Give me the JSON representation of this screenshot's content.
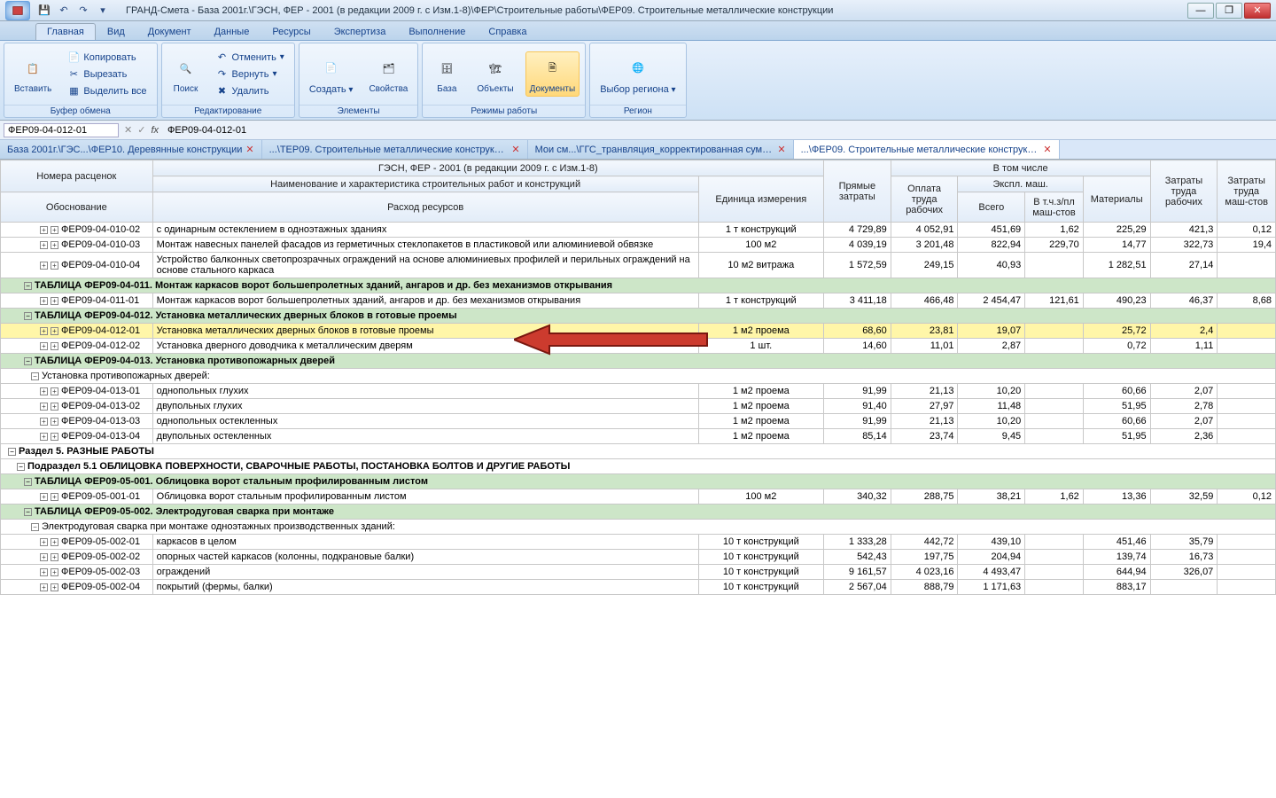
{
  "app_title": "ГРАНД-Смета - База 2001г.\\ГЭСН, ФЕР - 2001 (в редакции 2009 г. с Изм.1-8)\\ФЕР\\Строительные работы\\ФЕР09. Строительные металлические конструкции",
  "tabs": [
    "Главная",
    "Вид",
    "Документ",
    "Данные",
    "Ресурсы",
    "Экспертиза",
    "Выполнение",
    "Справка"
  ],
  "ribbon": {
    "paste": "Вставить",
    "copy": "Копировать",
    "cut": "Вырезать",
    "selectall": "Выделить все",
    "g_clipboard": "Буфер обмена",
    "search": "Поиск",
    "undo": "Отменить",
    "redo": "Вернуть",
    "delete": "Удалить",
    "g_edit": "Редактирование",
    "create": "Создать",
    "props": "Свойства",
    "g_elements": "Элементы",
    "base": "База",
    "objects": "Объекты",
    "docs": "Документы",
    "g_modes": "Режимы работы",
    "region": "Выбор региона",
    "g_region": "Регион"
  },
  "formula": {
    "name": "ФЕР09-04-012-01",
    "fx": "fx",
    "value": "ФЕР09-04-012-01"
  },
  "doc_tabs": [
    {
      "t": "База 2001г.\\ГЭС...\\ФЕР10. Деревянные конструкции",
      "a": false
    },
    {
      "t": "...\\ТЕР09. Строительные металлические конструкции",
      "a": false
    },
    {
      "t": "Мои см...\\ГГС_транвляция_корректированная сумма",
      "a": false
    },
    {
      "t": "...\\ФЕР09. Строительные металлические конструкции",
      "a": true
    }
  ],
  "headers": {
    "col_a1": "Номера расценок",
    "col_a2": "Обоснование",
    "col_b1": "Наименование и характеристика строительных работ и конструкций",
    "col_b2": "Расход ресурсов",
    "col_c1": "Единица измерения",
    "col_d": "Прямые затраты",
    "col_e": "В том числе",
    "col_e1": "Оплата труда рабочих",
    "col_e2": "Экспл. маш.",
    "col_e2a": "Всего",
    "col_e2b": "В т.ч.з/пл маш-стов",
    "col_e3": "Материалы",
    "col_f": "Затраты труда рабочих",
    "col_g": "Затраты труда маш-стов"
  },
  "rows": [
    {
      "type": "data",
      "ind": 38,
      "tw": "++",
      "code": "ФЕР09-04-010-02",
      "name": "с одинарным остеклением в одноэтажных зданиях",
      "unit": "1 т конструкций",
      "vals": [
        "4 729,89",
        "4 052,91",
        "451,69",
        "1,62",
        "225,29",
        "421,3",
        "0,12"
      ]
    },
    {
      "type": "data",
      "ind": 38,
      "tw": "++",
      "code": "ФЕР09-04-010-03",
      "name": "Монтаж навесных панелей фасадов из герметичных стеклопакетов в пластиковой или алюминиевой обвязке",
      "unit": "100 м2",
      "vals": [
        "4 039,19",
        "3 201,48",
        "822,94",
        "229,70",
        "14,77",
        "322,73",
        "19,4"
      ]
    },
    {
      "type": "data",
      "ind": 38,
      "tw": "++",
      "code": "ФЕР09-04-010-04",
      "name": "Устройство балконных светопрозрачных ограждений на основе алюминиевых профилей и перильных ограждений на основе стального каркаса",
      "unit": "10 м2 витража",
      "vals": [
        "1 572,59",
        "249,15",
        "40,93",
        "",
        "1 282,51",
        "27,14",
        ""
      ]
    },
    {
      "type": "green",
      "ind": 20,
      "tw": "-",
      "code": "ТАБЛИЦА ФЕР09-04-011.",
      "name": "Монтаж каркасов ворот большепролетных зданий, ангаров и др. без механизмов открывания"
    },
    {
      "type": "data",
      "ind": 38,
      "tw": "++",
      "code": "ФЕР09-04-011-01",
      "name": "Монтаж каркасов ворот большепролетных зданий, ангаров и др. без механизмов открывания",
      "unit": "1 т конструкций",
      "vals": [
        "3 411,18",
        "466,48",
        "2 454,47",
        "121,61",
        "490,23",
        "46,37",
        "8,68"
      ]
    },
    {
      "type": "green",
      "ind": 20,
      "tw": "-",
      "code": "ТАБЛИЦА ФЕР09-04-012.",
      "name": "Установка металлических дверных блоков в готовые проемы"
    },
    {
      "type": "sel",
      "ind": 38,
      "tw": "++",
      "code": "ФЕР09-04-012-01",
      "name": "Установка металлических дверных блоков в готовые проемы",
      "unit": "1 м2 проема",
      "vals": [
        "68,60",
        "23,81",
        "19,07",
        "",
        "25,72",
        "2,4",
        ""
      ]
    },
    {
      "type": "data",
      "ind": 38,
      "tw": "++",
      "code": "ФЕР09-04-012-02",
      "name": "Установка дверного доводчика к металлическим дверям",
      "unit": "1 шт.",
      "vals": [
        "14,60",
        "11,01",
        "2,87",
        "",
        "0,72",
        "1,11",
        ""
      ]
    },
    {
      "type": "green",
      "ind": 20,
      "tw": "-",
      "code": "ТАБЛИЦА ФЕР09-04-013.",
      "name": "Установка противопожарных дверей"
    },
    {
      "type": "sub",
      "ind": 28,
      "tw": "-",
      "name": "Установка противопожарных дверей:"
    },
    {
      "type": "data",
      "ind": 38,
      "tw": "++",
      "code": "ФЕР09-04-013-01",
      "name": "однопольных глухих",
      "unit": "1 м2 проема",
      "vals": [
        "91,99",
        "21,13",
        "10,20",
        "",
        "60,66",
        "2,07",
        ""
      ]
    },
    {
      "type": "data",
      "ind": 38,
      "tw": "++",
      "code": "ФЕР09-04-013-02",
      "name": "двупольных глухих",
      "unit": "1 м2 проема",
      "vals": [
        "91,40",
        "27,97",
        "11,48",
        "",
        "51,95",
        "2,78",
        ""
      ]
    },
    {
      "type": "data",
      "ind": 38,
      "tw": "++",
      "code": "ФЕР09-04-013-03",
      "name": "однопольных остекленных",
      "unit": "1 м2 проема",
      "vals": [
        "91,99",
        "21,13",
        "10,20",
        "",
        "60,66",
        "2,07",
        ""
      ]
    },
    {
      "type": "data",
      "ind": 38,
      "tw": "++",
      "code": "ФЕР09-04-013-04",
      "name": "двупольных остекленных",
      "unit": "1 м2 проема",
      "vals": [
        "85,14",
        "23,74",
        "9,45",
        "",
        "51,95",
        "2,36",
        ""
      ]
    },
    {
      "type": "section",
      "ind": 2,
      "tw": "-",
      "name": "Раздел 5. РАЗНЫЕ РАБОТЫ"
    },
    {
      "type": "section",
      "ind": 12,
      "tw": "-",
      "name": "Подраздел 5.1 ОБЛИЦОВКА ПОВЕРХНОСТИ, СВАРОЧНЫЕ РАБОТЫ, ПОСТАНОВКА БОЛТОВ И ДРУГИЕ РАБОТЫ"
    },
    {
      "type": "green",
      "ind": 20,
      "tw": "-",
      "code": "ТАБЛИЦА ФЕР09-05-001.",
      "name": "Облицовка ворот стальным профилированным листом"
    },
    {
      "type": "data",
      "ind": 38,
      "tw": "++",
      "code": "ФЕР09-05-001-01",
      "name": "Облицовка ворот стальным профилированным листом",
      "unit": "100 м2",
      "vals": [
        "340,32",
        "288,75",
        "38,21",
        "1,62",
        "13,36",
        "32,59",
        "0,12"
      ]
    },
    {
      "type": "green",
      "ind": 20,
      "tw": "-",
      "code": "ТАБЛИЦА ФЕР09-05-002.",
      "name": "Электродуговая сварка при монтаже"
    },
    {
      "type": "sub",
      "ind": 28,
      "tw": "-",
      "name": "Электродуговая сварка при монтаже одноэтажных производственных зданий:"
    },
    {
      "type": "data",
      "ind": 38,
      "tw": "++",
      "code": "ФЕР09-05-002-01",
      "name": "каркасов в целом",
      "unit": "10 т конструкций",
      "vals": [
        "1 333,28",
        "442,72",
        "439,10",
        "",
        "451,46",
        "35,79",
        ""
      ]
    },
    {
      "type": "data",
      "ind": 38,
      "tw": "++",
      "code": "ФЕР09-05-002-02",
      "name": "опорных частей каркасов (колонны, подкрановые балки)",
      "unit": "10 т конструкций",
      "vals": [
        "542,43",
        "197,75",
        "204,94",
        "",
        "139,74",
        "16,73",
        ""
      ]
    },
    {
      "type": "data",
      "ind": 38,
      "tw": "++",
      "code": "ФЕР09-05-002-03",
      "name": "ограждений",
      "unit": "10 т конструкций",
      "vals": [
        "9 161,57",
        "4 023,16",
        "4 493,47",
        "",
        "644,94",
        "326,07",
        ""
      ]
    },
    {
      "type": "data",
      "ind": 38,
      "tw": "++",
      "code": "ФЕР09-05-002-04",
      "name": "покрытий (фермы, балки)",
      "unit": "10 т конструкций",
      "vals": [
        "2 567,04",
        "888,79",
        "1 171,63",
        "",
        "883,17",
        "",
        ""
      ]
    }
  ]
}
